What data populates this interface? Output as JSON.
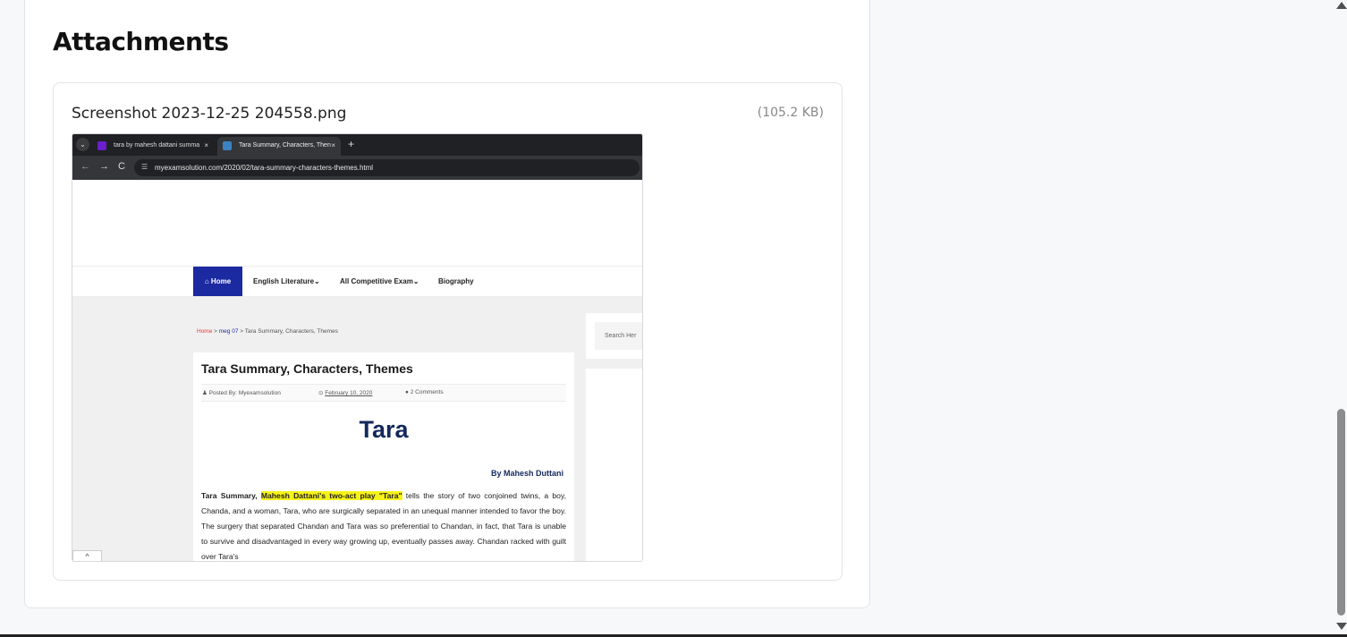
{
  "section": {
    "title": "Attachments"
  },
  "attachment": {
    "filename": "Screenshot 2023-12-25 204558.png",
    "size": "(105.2 KB)"
  },
  "preview": {
    "tabs": [
      {
        "label": "tara by mahesh dattani summa",
        "close": "×"
      },
      {
        "label": "Tara Summary, Characters, Then",
        "close": "×"
      }
    ],
    "new_tab": "+",
    "nav": {
      "back": "←",
      "forward": "→",
      "reload": "C"
    },
    "url": "myexamsolution.com/2020/02/tara-summary-characters-themes.html",
    "site_nav": {
      "home": "⌂ Home",
      "items": [
        "English Literature⌄",
        "All Competitive Exam⌄",
        "Biography"
      ]
    },
    "breadcrumb": {
      "home": "Home",
      "sep1": " > ",
      "category": "meg 07",
      "sep2": " > ",
      "current": "Tara Summary, Characters, Themes"
    },
    "article": {
      "title": "Tara Summary, Characters, Themes",
      "author": "Posted By: Myexamsolution",
      "date": "February 10, 2020",
      "comments": "2 Comments",
      "heading": "Tara",
      "byline": "By Mahesh Duttani",
      "body_lead": "Tara Summary, ",
      "body_highlight": "Mahesh Dattani's two-act play \"Tara\"",
      "body_rest": " tells the story of two conjoined twins, a boy, Chanda, and a woman, Tara, who are surgically separated in an unequal manner intended to favor the boy. The surgery that separated Chandan and Tara was so preferential to Chandan, in fact, that Tara is unable to survive and disadvantaged in every way growing up, eventually passes away. Chandan racked with guilt over Tara's"
    },
    "search_placeholder": "Search Her",
    "scroll_top": "^"
  }
}
